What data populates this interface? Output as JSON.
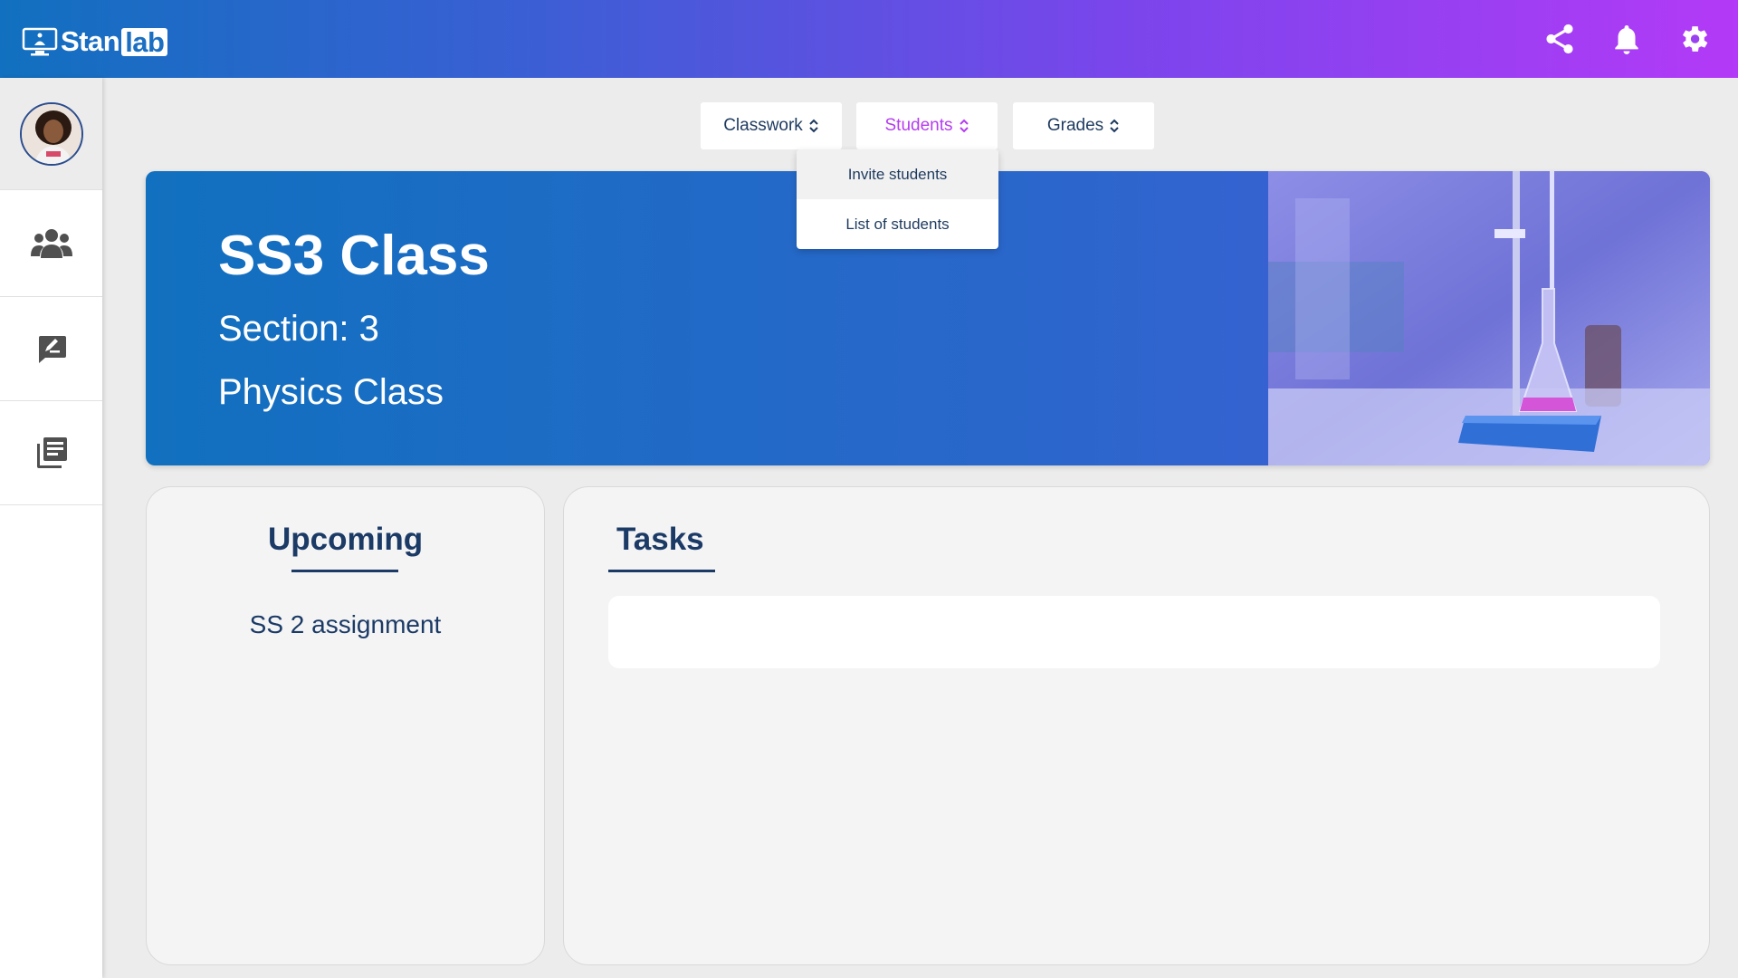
{
  "brand": {
    "name_prefix": "Stan",
    "name_suffix": "lab"
  },
  "topbar": {
    "icons": [
      "share-icon",
      "bell-icon",
      "gear-icon"
    ]
  },
  "sidebar": {
    "items": [
      {
        "icon": "users-icon"
      },
      {
        "icon": "chat-edit-icon"
      },
      {
        "icon": "library-icon"
      }
    ]
  },
  "tabs": [
    {
      "label": "Classwork"
    },
    {
      "label": "Students"
    },
    {
      "label": "Grades"
    }
  ],
  "students_menu": [
    {
      "label": "Invite students"
    },
    {
      "label": "List of students"
    }
  ],
  "banner": {
    "title": "SS3 Class",
    "section": "Section: 3",
    "subject": "Physics Class"
  },
  "upcoming": {
    "heading": "Upcoming",
    "items": [
      "SS 2 assignment"
    ]
  },
  "tasks": {
    "heading": "Tasks"
  },
  "colors": {
    "accent_active": "#b43cf0",
    "primary_blue": "#1170bf",
    "heading_navy": "#1b3a66"
  }
}
